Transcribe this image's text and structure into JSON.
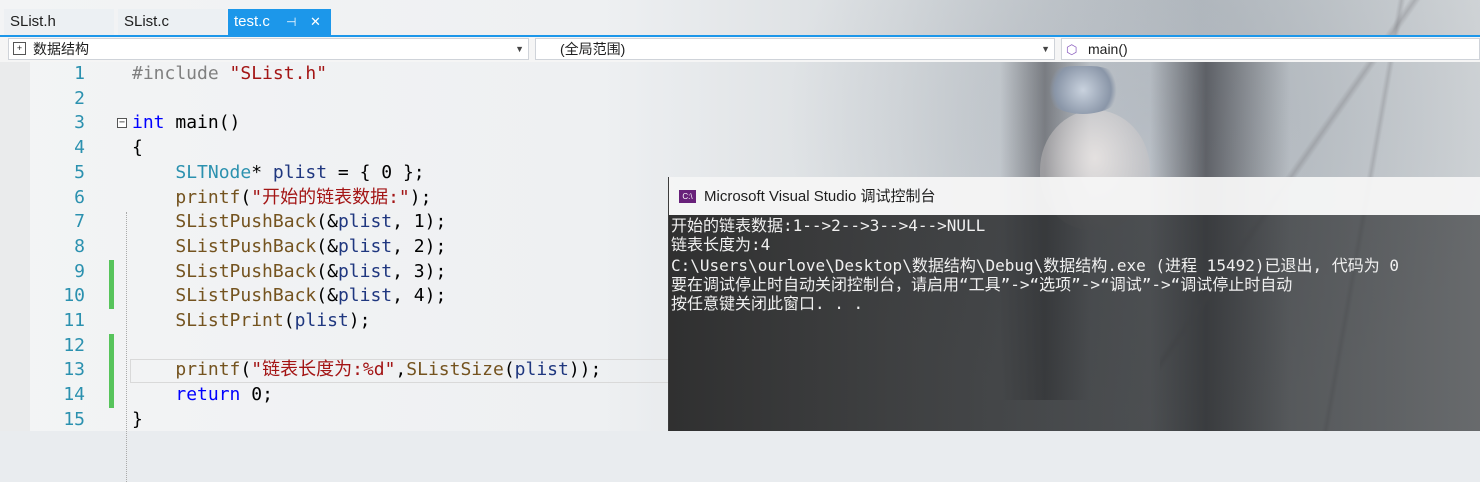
{
  "tabs": [
    {
      "label": "SList.h"
    },
    {
      "label": "SList.c"
    },
    {
      "label": "test.c",
      "active": true
    }
  ],
  "tab_pin_icon": "⊣",
  "tab_close_icon": "✕",
  "navbar": {
    "project": "数据结构",
    "scope": "(全局范围)",
    "member": "main()"
  },
  "editor": {
    "lines": [
      {
        "n": "1"
      },
      {
        "n": "2"
      },
      {
        "n": "3"
      },
      {
        "n": "4"
      },
      {
        "n": "5"
      },
      {
        "n": "6"
      },
      {
        "n": "7"
      },
      {
        "n": "8"
      },
      {
        "n": "9"
      },
      {
        "n": "10"
      },
      {
        "n": "11"
      },
      {
        "n": "12"
      },
      {
        "n": "13"
      },
      {
        "n": "14"
      },
      {
        "n": "15"
      }
    ],
    "code": {
      "l1_pp": "#include ",
      "l1_str": "\"SList.h\"",
      "l3_kw": "int",
      "l3_rest": " main()",
      "l4": "{",
      "l5_ty": "SLTNode",
      "l5_a": "* ",
      "l5_var": "plist",
      "l5_b": " = { 0 };",
      "l6_fn": "printf",
      "l6_a": "(",
      "l6_str": "\"开始的链表数据:\"",
      "l6_b": ");",
      "l7_fn": "SListPushBack",
      "l7_a": "(&",
      "l7_var": "plist",
      "l7_b": ", 1);",
      "l8_fn": "SListPushBack",
      "l8_a": "(&",
      "l8_var": "plist",
      "l8_b": ", 2);",
      "l9_fn": "SListPushBack",
      "l9_a": "(&",
      "l9_var": "plist",
      "l9_b": ", 3);",
      "l10_fn": "SListPushBack",
      "l10_a": "(&",
      "l10_var": "plist",
      "l10_b": ", 4);",
      "l11_fn": "SListPrint",
      "l11_a": "(",
      "l11_var": "plist",
      "l11_b": ");",
      "l13_fn": "printf",
      "l13_a": "(",
      "l13_str": "\"链表长度为:%d\"",
      "l13_b": ",",
      "l13_fn2": "SListSize",
      "l13_c": "(",
      "l13_var": "plist",
      "l13_d": "));",
      "l14_kw": "return",
      "l14_b": " 0;",
      "l15": "}"
    },
    "changed_lines": [
      9,
      10,
      12,
      13,
      14
    ]
  },
  "console": {
    "title": "Microsoft Visual Studio 调试控制台",
    "icon_label": "C:\\",
    "lines": [
      "开始的链表数据:1-->2-->3-->4-->NULL",
      "链表长度为:4",
      "C:\\Users\\ourlove\\Desktop\\数据结构\\Debug\\数据结构.exe (进程 15492)已退出, 代码为 0",
      "要在调试停止时自动关闭控制台，请启用“工具”->“选项”->“调试”->“调试停止时自动",
      "按任意键关闭此窗口. . ."
    ]
  },
  "colors": {
    "accent": "#1c97ea",
    "keyword": "#0000ff",
    "string": "#a31515",
    "type": "#2b91af",
    "change_bar": "#57c45b"
  }
}
